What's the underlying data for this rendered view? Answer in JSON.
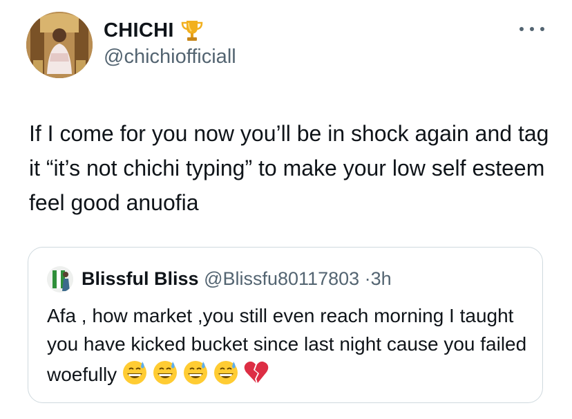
{
  "author": {
    "display_name": "CHICHI",
    "handle": "@chichiofficiall",
    "badge_icon": "trophy-icon",
    "avatar_icon": "avatar-photo"
  },
  "tweet": {
    "text": "If I come for you now you’ll be in shock again and tag it “it’s not chichi typing” to make your low self esteem feel good anuofia"
  },
  "quoted_tweet": {
    "display_name": "Blissful Bliss",
    "handle": "@Blissfu80117803",
    "separator": "·",
    "time": "3h",
    "text": "Afa , how market ,you still even reach morning I taught you have kicked bucket since last night cause you failed woefully",
    "emojis": [
      "grinning-sweat-emoji",
      "grinning-sweat-emoji",
      "grinning-sweat-emoji",
      "grinning-sweat-emoji",
      "broken-heart-emoji"
    ]
  },
  "menu_icon": "more-options-icon",
  "colors": {
    "text_primary": "#0f1419",
    "text_secondary": "#536471",
    "border": "#cfd9de",
    "trophy": "#f2b01e",
    "broken_heart": "#dd2e44"
  }
}
